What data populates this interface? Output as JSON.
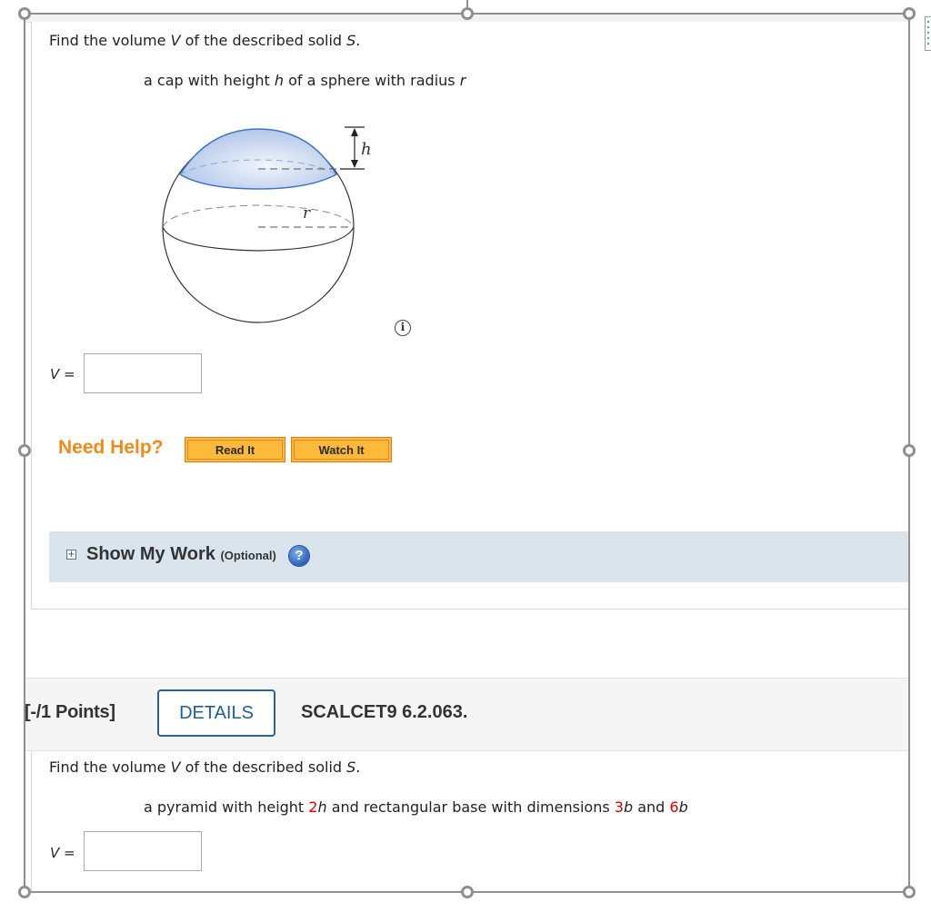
{
  "question1": {
    "prompt_prefix": "Find the volume ",
    "prompt_var_v": "V",
    "prompt_mid": " of the described solid ",
    "prompt_var_s": "S",
    "prompt_end": ".",
    "description_parts": [
      "a cap with height ",
      "h",
      " of a sphere with radius ",
      "r"
    ],
    "figure": {
      "label_h": "h",
      "label_r": "r",
      "cap_fill_color": "#c9d8f0",
      "cap_stroke_color": "#3d74c2"
    },
    "info_icon": "info-icon",
    "answer_label": "V =",
    "answer_value": "",
    "need_help": {
      "label": "Need Help?",
      "buttons": [
        "Read It",
        "Watch It"
      ]
    },
    "show_my_work": {
      "expand_icon": "plus-square-icon",
      "title": "Show My Work",
      "optional": "(Optional)",
      "help_icon": "question-circle-icon",
      "help_glyph": "?"
    }
  },
  "question2": {
    "points": "[-/1 Points]",
    "details_button": "DETAILS",
    "question_id": "SCALCET9 6.2.063.",
    "prompt_prefix": "Find the volume ",
    "prompt_var_v": "V",
    "prompt_mid": " of the described solid ",
    "prompt_var_s": "S",
    "prompt_end": ".",
    "description": {
      "p1": "a pyramid with height ",
      "height_coef": "2",
      "height_var": "h",
      "p2": " and rectangular base with dimensions ",
      "dim1_coef": "3",
      "dim1_var": "b",
      "p3": " and ",
      "dim2_coef": "6",
      "dim2_var": "b"
    },
    "answer_label": "V =",
    "answer_value": ""
  },
  "colors": {
    "highlight_red": "#d40000",
    "need_help_orange": "#f08a1d",
    "button_orange": "#fdb93a",
    "details_blue": "#1f5f95",
    "show_my_work_bg": "#d9e4ed"
  }
}
